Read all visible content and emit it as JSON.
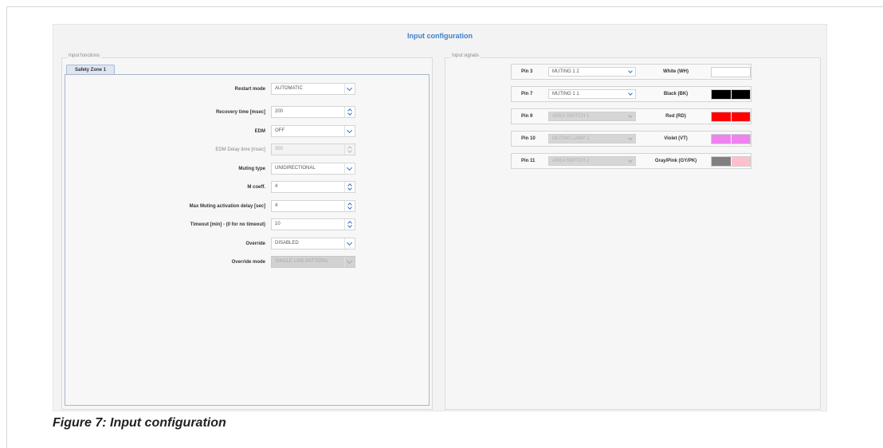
{
  "title": "Input configuration",
  "input_functions": {
    "legend": "Input functions",
    "tab": "Safety Zone 1",
    "fields": [
      {
        "label": "Restart mode",
        "value": "AUTOMATIC",
        "kind": "select",
        "state": "enabled"
      },
      {
        "label": "Recovery time [msec]",
        "value": "200",
        "kind": "spinner",
        "state": "enabled"
      },
      {
        "label": "EDM",
        "value": "OFF",
        "kind": "select",
        "state": "enabled"
      },
      {
        "label": "EDM Delay time [msec]",
        "value": "350",
        "kind": "spinner",
        "state": "disabled"
      },
      {
        "label": "Muting type",
        "value": "UNIDIRECTIONAL",
        "kind": "select",
        "state": "enabled"
      },
      {
        "label": "M coeff.",
        "value": "4",
        "kind": "spinner",
        "state": "enabled"
      },
      {
        "label": "Max Muting activation delay [sec]",
        "value": "4",
        "kind": "spinner",
        "state": "enabled"
      },
      {
        "label": "Timeout [min] - (0 for no timeout)",
        "value": "10",
        "kind": "spinner",
        "state": "enabled"
      },
      {
        "label": "Override",
        "value": "DISABLED",
        "kind": "select",
        "state": "enabled"
      },
      {
        "label": "Override mode",
        "value": "SINGLE LINE PATTERN",
        "kind": "select",
        "state": "greyed"
      }
    ]
  },
  "input_signals": {
    "legend": "Input signals",
    "rows": [
      {
        "pin": "Pin 3",
        "signal": "MUTING 1 2",
        "state": "enabled",
        "wire": "White (WH)",
        "colors": [
          "#ffffff",
          "#ffffff"
        ]
      },
      {
        "pin": "Pin 7",
        "signal": "MUTING 1 1",
        "state": "enabled",
        "wire": "Black (BK)",
        "colors": [
          "#000000",
          "#000000"
        ]
      },
      {
        "pin": "Pin 9",
        "signal": "AREA SWITCH 1",
        "state": "greyed",
        "wire": "Red (RD)",
        "colors": [
          "#ff0000",
          "#ff0000"
        ]
      },
      {
        "pin": "Pin 10",
        "signal": "MUTING LAMP 1",
        "state": "greyed",
        "wire": "Violet (VT)",
        "colors": [
          "#ee82ee",
          "#ee82ee"
        ]
      },
      {
        "pin": "Pin 11",
        "signal": "AREA SWITCH 2",
        "state": "greyed",
        "wire": "Gray/Pink (GY/PK)",
        "colors": [
          "#808080",
          "#ffc0cb"
        ]
      }
    ]
  },
  "caption": "Figure 7: Input configuration"
}
